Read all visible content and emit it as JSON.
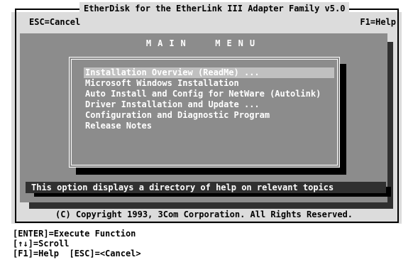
{
  "window": {
    "title": "EtherDisk for the EtherLink III Adapter Family v5.0",
    "esc_hint": "ESC=Cancel",
    "help_hint": "F1=Help"
  },
  "menu": {
    "title": "MAIN  MENU",
    "items": [
      {
        "label": "Installation Overview (ReadMe) ...",
        "selected": true
      },
      {
        "label": "Microsoft Windows Installation",
        "selected": false
      },
      {
        "label": "Auto Install and Config for NetWare (Autolink)",
        "selected": false
      },
      {
        "label": "Driver Installation and Update ...",
        "selected": false
      },
      {
        "label": "Configuration and Diagnostic Program",
        "selected": false
      },
      {
        "label": "Release Notes",
        "selected": false
      }
    ]
  },
  "status": {
    "text": "This option displays a directory of help on relevant topics"
  },
  "copyright": "(C) Copyright 1993, 3Com Corporation. All Rights Reserved.",
  "key_help": [
    "[ENTER]=Execute Function",
    "[↑↓]=Scroll",
    "[F1]=Help  [ESC]=<Cancel>"
  ],
  "colors": {
    "screen_background": "#dcdcdc",
    "panel": "#8c8c8c",
    "panel_shadow": "#303030",
    "selection_highlight": "#c0c0c0",
    "text_light": "#ffffff",
    "text_dark": "#000000"
  }
}
